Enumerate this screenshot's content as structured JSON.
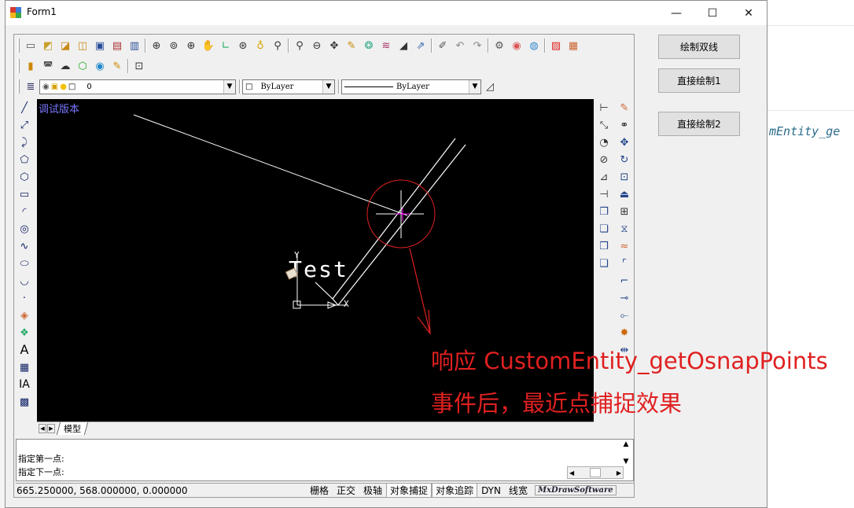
{
  "window": {
    "title": "Form1",
    "minimize": "—",
    "maximize": "☐",
    "close": "✕"
  },
  "background_editor": {
    "code_fragment": "mEntity_ge"
  },
  "toolbar1": {
    "icons": [
      "new-icon",
      "open-icon",
      "open-folder-icon",
      "open-recent-icon",
      "save-icon",
      "print-icon",
      "print-preview-icon",
      "zoom-realtime-icon",
      "zoom-window-icon",
      "zoom-in-icon",
      "pan-icon",
      "zoom-extents-icon",
      "measure-icon",
      "light-icon",
      "plot-icon",
      "find-icon",
      "zoom-out-icon",
      "move-icon",
      "pencil-icon",
      "colors-icon",
      "layers-icon",
      "draw-icon",
      "export-icon",
      "properties-icon",
      "undo-icon",
      "redo-icon",
      "tools-icon",
      "palette-icon",
      "render-icon",
      "pdf-icon",
      "image-icon"
    ]
  },
  "toolbar2": {
    "icons": [
      "block-icon",
      "insert-image-icon",
      "cloud-icon",
      "hatch-icon",
      "circle-icon",
      "pen-icon",
      "zoom-preview-icon"
    ]
  },
  "layer_toolbar": {
    "layer_value": "0",
    "color_value": "ByLayer",
    "linetype_value": "ByLayer"
  },
  "canvas": {
    "watermark": "调试版本",
    "text_entity": "Test",
    "ucs_y": "Y",
    "ucs_x": "X"
  },
  "tabs": {
    "model_tab": "模型"
  },
  "command": {
    "line1": "指定第一点:",
    "line2": "指定下一点:"
  },
  "status": {
    "coords": "665.250000,  568.000000,  0.000000",
    "grid": "栅格",
    "ortho": "正交",
    "polar": "极轴",
    "osnap": "对象捕捉",
    "otrack": "对象追踪",
    "dyn": "DYN",
    "lweight": "线宽",
    "brand": "MxDrawSoftware"
  },
  "buttons": {
    "draw_double_line": "绘制双线",
    "direct_draw_1": "直接绘制1",
    "direct_draw_2": "直接绘制2"
  },
  "annotation": {
    "line1": "响应 CustomEntity_getOsnapPoints",
    "line2": "事件后，最近点捕捉效果"
  },
  "colors": {
    "annotation_red": "#e02020",
    "canvas_bg": "#000000",
    "watermark_blue": "#7777ff",
    "osnap_magenta": "#ff00ff"
  }
}
